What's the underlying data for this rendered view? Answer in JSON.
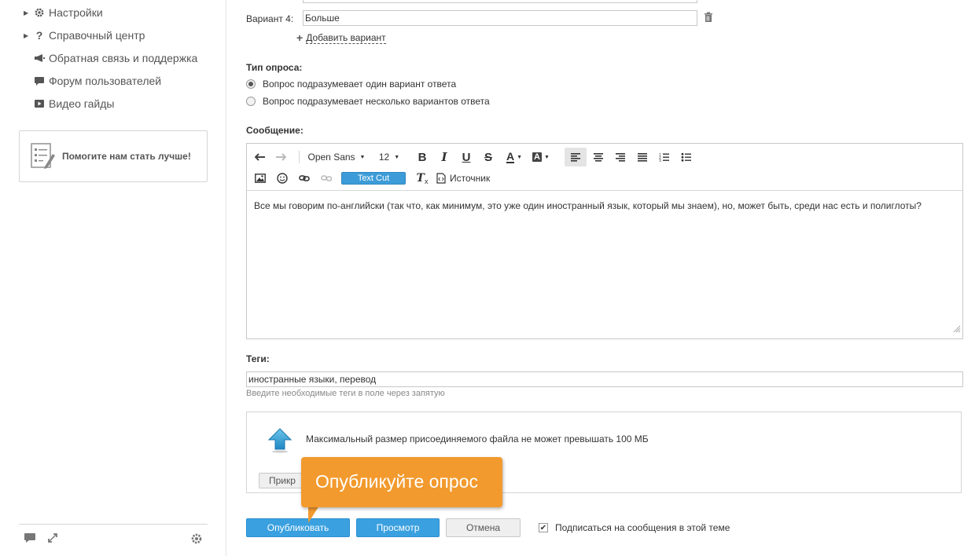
{
  "sidebar": {
    "items": [
      {
        "label": "Настройки",
        "icon": "gear-icon",
        "expandable": true
      },
      {
        "label": "Справочный центр",
        "icon": "question-icon",
        "expandable": true
      },
      {
        "label": "Обратная связь и поддержка",
        "icon": "megaphone-icon",
        "expandable": false
      },
      {
        "label": "Форум пользователей",
        "icon": "chat-icon",
        "expandable": false
      },
      {
        "label": "Видео гайды",
        "icon": "video-icon",
        "expandable": false
      }
    ],
    "help_box_label": "Помогите нам стать лучше!"
  },
  "poll": {
    "variant4_label": "Вариант 4:",
    "variant4_value": "Больше",
    "add_variant_label": "Добавить вариант",
    "poll_type_heading": "Тип опроса:",
    "poll_type_options": [
      {
        "label": "Вопрос подразумевает один вариант ответа",
        "checked": true
      },
      {
        "label": "Вопрос подразумевает несколько вариантов ответа",
        "checked": false
      }
    ]
  },
  "message": {
    "heading": "Сообщение:",
    "font_family": "Open Sans",
    "font_size": "12",
    "text_cut_label": "Text Cut",
    "source_label": "Источник",
    "body": "Все мы говорим по-английски (так что, как минимум, это уже один иностранный язык, который мы знаем), но, может быть, среди нас есть и полиглоты?"
  },
  "tags": {
    "heading": "Теги:",
    "value": "иностранные языки, перевод",
    "hint": "Введите необходимые теги в поле через запятую"
  },
  "attachment": {
    "note": "Максимальный размер присоединяемого файла не может превышать 100 МБ",
    "attach_button_label": "Прикр"
  },
  "tooltip": {
    "text": "Опубликуйте опрос"
  },
  "actions": {
    "publish_label": "Опубликовать",
    "preview_label": "Просмотр",
    "cancel_label": "Отмена",
    "subscribe_label": "Подписаться на сообщения в этой теме",
    "subscribe_checked": true
  },
  "colors": {
    "accent_blue": "#3aa0e0",
    "tooltip_orange": "#f29a2e",
    "text_cut_blue": "#3d9cd8"
  }
}
